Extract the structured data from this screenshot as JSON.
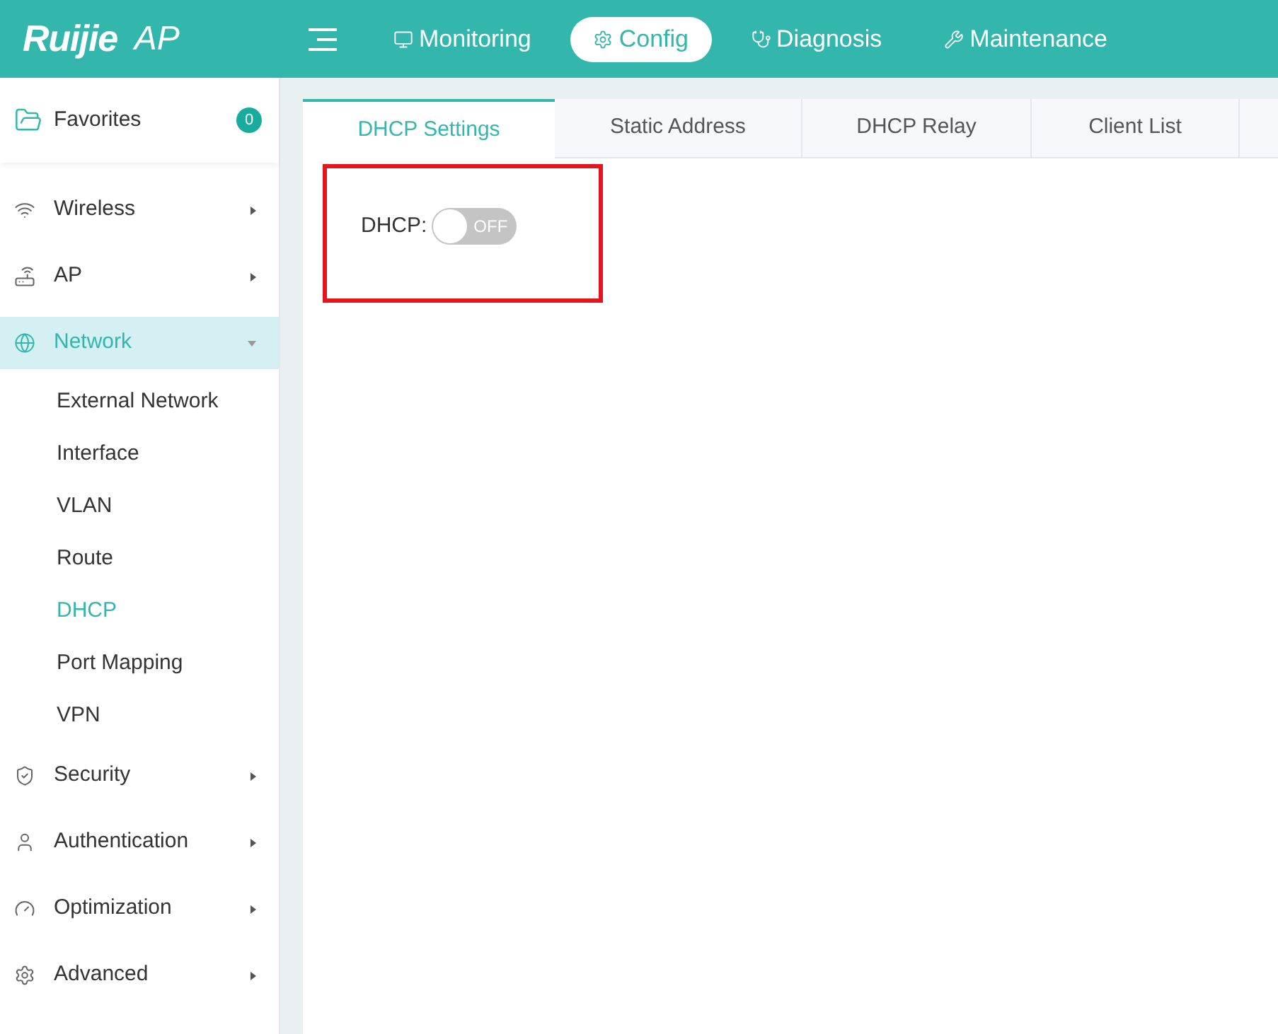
{
  "header": {
    "logo": "Ruijie",
    "product": "AP",
    "nav": [
      {
        "label": "Monitoring",
        "selected": false
      },
      {
        "label": "Config",
        "selected": true
      },
      {
        "label": "Diagnosis",
        "selected": false
      },
      {
        "label": "Maintenance",
        "selected": false
      }
    ]
  },
  "sidebar": {
    "favorites": {
      "label": "Favorites",
      "count": "0"
    },
    "items": [
      {
        "label": "Wireless",
        "expanded": false,
        "selected": false
      },
      {
        "label": "AP",
        "expanded": false,
        "selected": false
      },
      {
        "label": "Network",
        "expanded": true,
        "selected": true,
        "children": [
          {
            "label": "External Network",
            "selected": false
          },
          {
            "label": "Interface",
            "selected": false
          },
          {
            "label": "VLAN",
            "selected": false
          },
          {
            "label": "Route",
            "selected": false
          },
          {
            "label": "DHCP",
            "selected": true
          },
          {
            "label": "Port Mapping",
            "selected": false
          },
          {
            "label": "VPN",
            "selected": false
          }
        ]
      },
      {
        "label": "Security",
        "expanded": false,
        "selected": false
      },
      {
        "label": "Authentication",
        "expanded": false,
        "selected": false
      },
      {
        "label": "Optimization",
        "expanded": false,
        "selected": false
      },
      {
        "label": "Advanced",
        "expanded": false,
        "selected": false
      }
    ]
  },
  "tabs": [
    {
      "label": "DHCP Settings",
      "selected": true
    },
    {
      "label": "Static Address",
      "selected": false
    },
    {
      "label": "DHCP Relay",
      "selected": false
    },
    {
      "label": "Client List",
      "selected": false
    }
  ],
  "dhcp": {
    "label": "DHCP:",
    "on": false,
    "state_text": "OFF"
  }
}
